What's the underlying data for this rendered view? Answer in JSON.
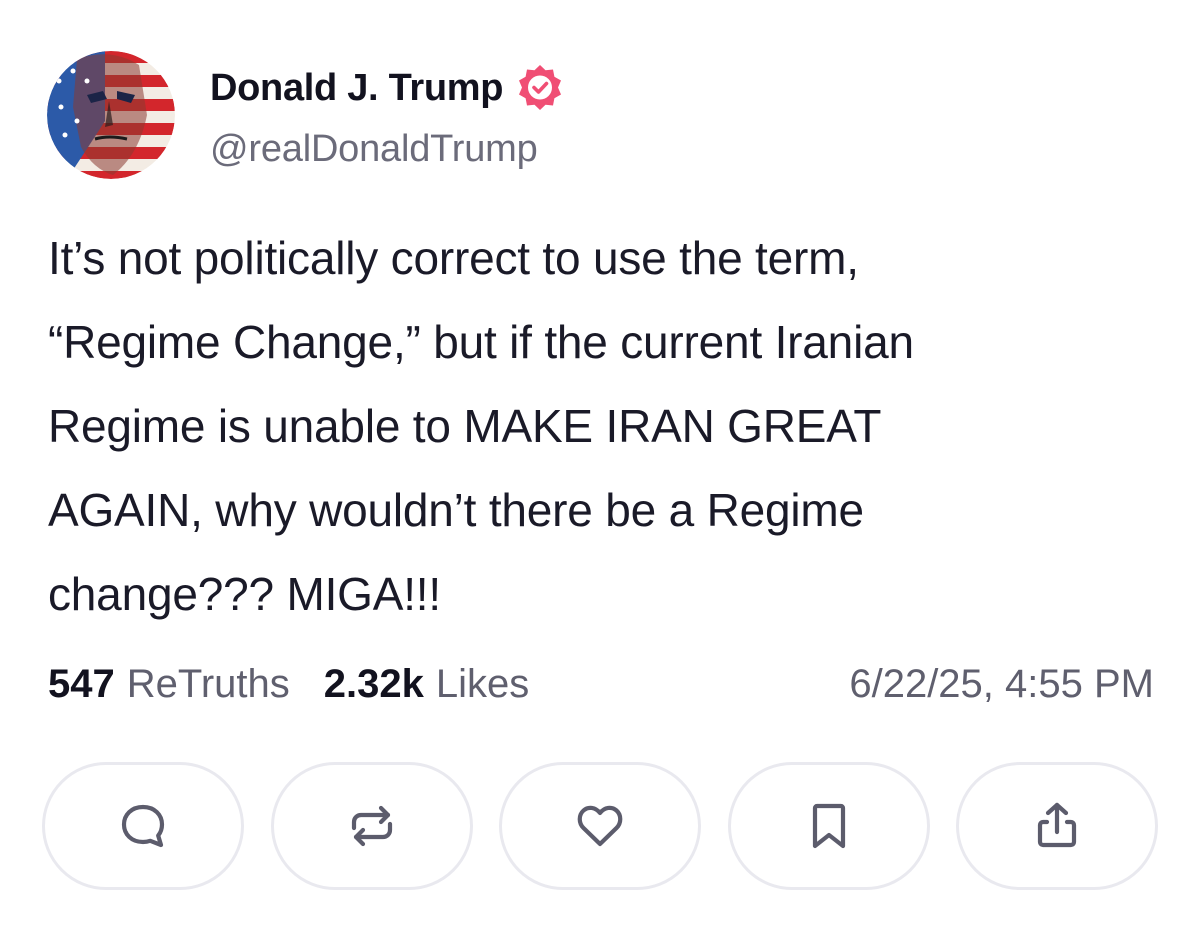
{
  "author": {
    "name": "Donald J. Trump",
    "handle": "@realDonaldTrump",
    "verified": true,
    "avatar_icon": "flag-portrait-avatar"
  },
  "post": {
    "text": "It’s not politically correct to use the term,\n“Regime Change,” but if the current Iranian\nRegime is unable to MAKE IRAN GREAT\nAGAIN, why wouldn’t there be a Regime\nchange??? MIGA!!!"
  },
  "stats": {
    "retruths_count": "547",
    "retruths_label": "ReTruths",
    "likes_count": "2.32k",
    "likes_label": "Likes",
    "timestamp": "6/22/25, 4:55 PM"
  },
  "actions": [
    {
      "icon": "reply-icon"
    },
    {
      "icon": "retruth-icon"
    },
    {
      "icon": "heart-icon"
    },
    {
      "icon": "bookmark-icon"
    },
    {
      "icon": "share-icon"
    }
  ],
  "colors": {
    "verified_badge": "#f04e74",
    "text_primary": "#1a1a28",
    "text_secondary": "#5f5f6e",
    "button_border": "#e9e9ef",
    "icon_stroke": "#5c5c6c"
  }
}
